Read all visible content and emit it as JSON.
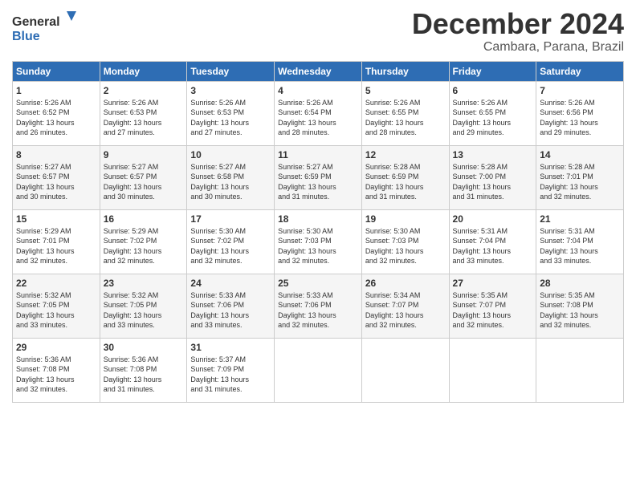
{
  "logo": {
    "text_general": "General",
    "text_blue": "Blue"
  },
  "header": {
    "month": "December 2024",
    "location": "Cambara, Parana, Brazil"
  },
  "days_of_week": [
    "Sunday",
    "Monday",
    "Tuesday",
    "Wednesday",
    "Thursday",
    "Friday",
    "Saturday"
  ],
  "weeks": [
    [
      {
        "day": "1",
        "content": "Sunrise: 5:26 AM\nSunset: 6:52 PM\nDaylight: 13 hours\nand 26 minutes."
      },
      {
        "day": "2",
        "content": "Sunrise: 5:26 AM\nSunset: 6:53 PM\nDaylight: 13 hours\nand 27 minutes."
      },
      {
        "day": "3",
        "content": "Sunrise: 5:26 AM\nSunset: 6:53 PM\nDaylight: 13 hours\nand 27 minutes."
      },
      {
        "day": "4",
        "content": "Sunrise: 5:26 AM\nSunset: 6:54 PM\nDaylight: 13 hours\nand 28 minutes."
      },
      {
        "day": "5",
        "content": "Sunrise: 5:26 AM\nSunset: 6:55 PM\nDaylight: 13 hours\nand 28 minutes."
      },
      {
        "day": "6",
        "content": "Sunrise: 5:26 AM\nSunset: 6:55 PM\nDaylight: 13 hours\nand 29 minutes."
      },
      {
        "day": "7",
        "content": "Sunrise: 5:26 AM\nSunset: 6:56 PM\nDaylight: 13 hours\nand 29 minutes."
      }
    ],
    [
      {
        "day": "8",
        "content": "Sunrise: 5:27 AM\nSunset: 6:57 PM\nDaylight: 13 hours\nand 30 minutes."
      },
      {
        "day": "9",
        "content": "Sunrise: 5:27 AM\nSunset: 6:57 PM\nDaylight: 13 hours\nand 30 minutes."
      },
      {
        "day": "10",
        "content": "Sunrise: 5:27 AM\nSunset: 6:58 PM\nDaylight: 13 hours\nand 30 minutes."
      },
      {
        "day": "11",
        "content": "Sunrise: 5:27 AM\nSunset: 6:59 PM\nDaylight: 13 hours\nand 31 minutes."
      },
      {
        "day": "12",
        "content": "Sunrise: 5:28 AM\nSunset: 6:59 PM\nDaylight: 13 hours\nand 31 minutes."
      },
      {
        "day": "13",
        "content": "Sunrise: 5:28 AM\nSunset: 7:00 PM\nDaylight: 13 hours\nand 31 minutes."
      },
      {
        "day": "14",
        "content": "Sunrise: 5:28 AM\nSunset: 7:01 PM\nDaylight: 13 hours\nand 32 minutes."
      }
    ],
    [
      {
        "day": "15",
        "content": "Sunrise: 5:29 AM\nSunset: 7:01 PM\nDaylight: 13 hours\nand 32 minutes."
      },
      {
        "day": "16",
        "content": "Sunrise: 5:29 AM\nSunset: 7:02 PM\nDaylight: 13 hours\nand 32 minutes."
      },
      {
        "day": "17",
        "content": "Sunrise: 5:30 AM\nSunset: 7:02 PM\nDaylight: 13 hours\nand 32 minutes."
      },
      {
        "day": "18",
        "content": "Sunrise: 5:30 AM\nSunset: 7:03 PM\nDaylight: 13 hours\nand 32 minutes."
      },
      {
        "day": "19",
        "content": "Sunrise: 5:30 AM\nSunset: 7:03 PM\nDaylight: 13 hours\nand 32 minutes."
      },
      {
        "day": "20",
        "content": "Sunrise: 5:31 AM\nSunset: 7:04 PM\nDaylight: 13 hours\nand 33 minutes."
      },
      {
        "day": "21",
        "content": "Sunrise: 5:31 AM\nSunset: 7:04 PM\nDaylight: 13 hours\nand 33 minutes."
      }
    ],
    [
      {
        "day": "22",
        "content": "Sunrise: 5:32 AM\nSunset: 7:05 PM\nDaylight: 13 hours\nand 33 minutes."
      },
      {
        "day": "23",
        "content": "Sunrise: 5:32 AM\nSunset: 7:05 PM\nDaylight: 13 hours\nand 33 minutes."
      },
      {
        "day": "24",
        "content": "Sunrise: 5:33 AM\nSunset: 7:06 PM\nDaylight: 13 hours\nand 33 minutes."
      },
      {
        "day": "25",
        "content": "Sunrise: 5:33 AM\nSunset: 7:06 PM\nDaylight: 13 hours\nand 32 minutes."
      },
      {
        "day": "26",
        "content": "Sunrise: 5:34 AM\nSunset: 7:07 PM\nDaylight: 13 hours\nand 32 minutes."
      },
      {
        "day": "27",
        "content": "Sunrise: 5:35 AM\nSunset: 7:07 PM\nDaylight: 13 hours\nand 32 minutes."
      },
      {
        "day": "28",
        "content": "Sunrise: 5:35 AM\nSunset: 7:08 PM\nDaylight: 13 hours\nand 32 minutes."
      }
    ],
    [
      {
        "day": "29",
        "content": "Sunrise: 5:36 AM\nSunset: 7:08 PM\nDaylight: 13 hours\nand 32 minutes."
      },
      {
        "day": "30",
        "content": "Sunrise: 5:36 AM\nSunset: 7:08 PM\nDaylight: 13 hours\nand 31 minutes."
      },
      {
        "day": "31",
        "content": "Sunrise: 5:37 AM\nSunset: 7:09 PM\nDaylight: 13 hours\nand 31 minutes."
      },
      {
        "day": "",
        "content": ""
      },
      {
        "day": "",
        "content": ""
      },
      {
        "day": "",
        "content": ""
      },
      {
        "day": "",
        "content": ""
      }
    ]
  ]
}
